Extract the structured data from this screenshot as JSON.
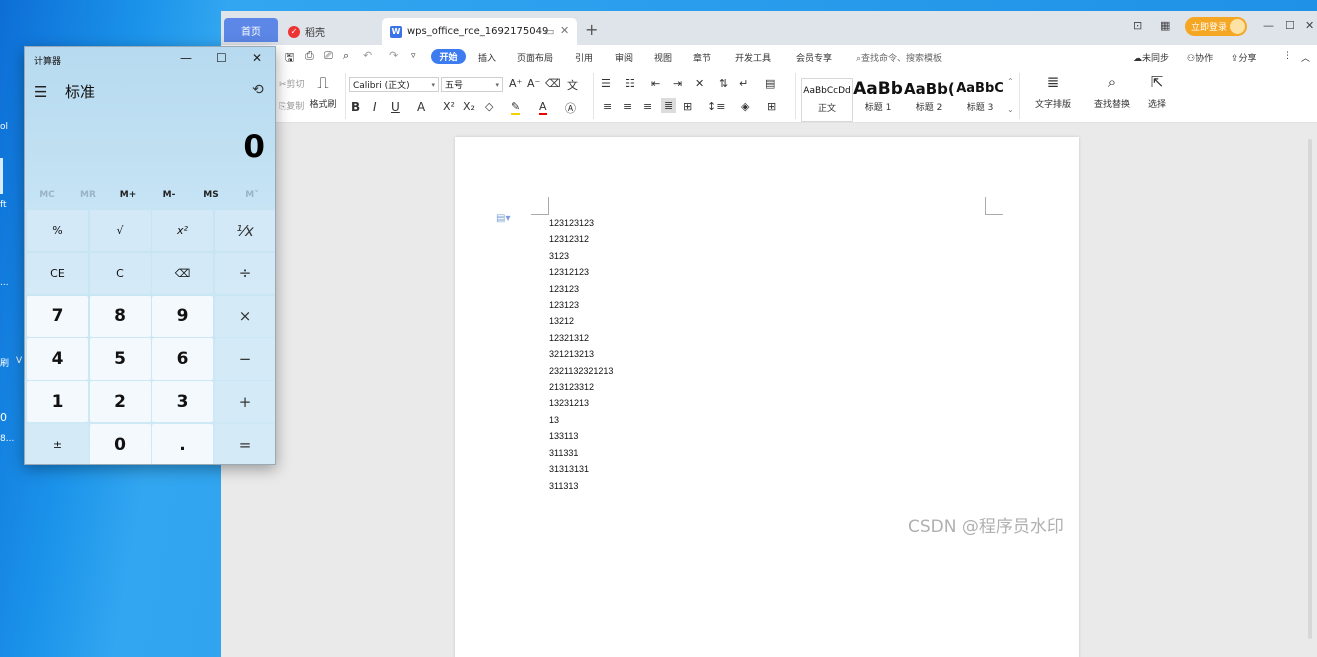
{
  "desktop": {
    "fragments": [
      {
        "text": "ol"
      },
      {
        "text": "ft"
      },
      {
        "text": "..."
      },
      {
        "text": "刷"
      },
      {
        "text": "V"
      },
      {
        "text": "0"
      },
      {
        "text": "8..."
      }
    ]
  },
  "wps": {
    "tabs": {
      "home": "首页",
      "daoke": "稻壳",
      "doc": "wps_office_rce_1692175049",
      "doc_logo": "W"
    },
    "login": "立即登录",
    "menu": {
      "start": "开始",
      "items": [
        "插入",
        "页面布局",
        "引用",
        "审阅",
        "视图",
        "章节",
        "开发工具",
        "会员专享"
      ],
      "search": "查找命令、搜索模板",
      "right": [
        "未同步",
        "协作",
        "分享"
      ]
    },
    "ribbon": {
      "cut": "剪切",
      "copy": "复制",
      "format_painter": "格式刷",
      "font_name": "Calibri (正文)",
      "font_size": "五号",
      "styles": [
        {
          "preview": "AaBbCcDd",
          "label": "正文"
        },
        {
          "preview": "AaBb",
          "label": "标题 1"
        },
        {
          "preview": "AaBb(",
          "label": "标题 2"
        },
        {
          "preview": "AaBbC",
          "label": "标题 3"
        }
      ],
      "text_layout": "文字排版",
      "find_replace": "查找替换",
      "select": "选择"
    },
    "document": {
      "lines": [
        "123123123",
        "12312312",
        "3123",
        "12312123",
        "123123",
        "123123",
        "13212",
        "12321312",
        "321213213",
        "2321132321213",
        "213123312",
        "13231213",
        "13",
        "133113",
        "311331",
        "31313131",
        "311313"
      ]
    }
  },
  "watermark": "CSDN @程序员水印",
  "calculator": {
    "title": "计算器",
    "mode": "标准",
    "display": "0",
    "memory": [
      "MC",
      "MR",
      "M+",
      "M-",
      "MS",
      "M˅"
    ],
    "keys": [
      [
        "%",
        "√",
        "x²",
        "⅟x"
      ],
      [
        "CE",
        "C",
        "⌫",
        "÷"
      ],
      [
        "7",
        "8",
        "9",
        "×"
      ],
      [
        "4",
        "5",
        "6",
        "−"
      ],
      [
        "1",
        "2",
        "3",
        "+"
      ],
      [
        "±",
        "0",
        ".",
        "="
      ]
    ]
  }
}
